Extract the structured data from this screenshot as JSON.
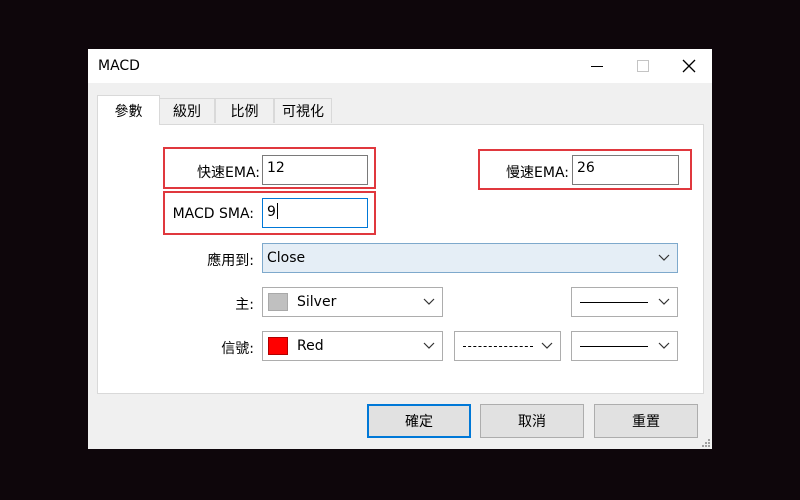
{
  "window": {
    "title": "MACD"
  },
  "tabs": [
    {
      "label": "參數",
      "active": true
    },
    {
      "label": "級別",
      "active": false
    },
    {
      "label": "比例",
      "active": false
    },
    {
      "label": "可視化",
      "active": false
    }
  ],
  "params": {
    "fast_ema_label": "快速EMA:",
    "fast_ema_value": "12",
    "slow_ema_label": "慢速EMA:",
    "slow_ema_value": "26",
    "macd_sma_label": "MACD SMA:",
    "macd_sma_value": "9",
    "apply_to_label": "應用到:",
    "apply_to_value": "Close",
    "main_label": "主:",
    "main_color_name": "Silver",
    "main_color": "#c0c0c0",
    "signal_label": "信號:",
    "signal_color_name": "Red",
    "signal_color": "#ff0000"
  },
  "buttons": {
    "ok": "確定",
    "cancel": "取消",
    "reset": "重置"
  },
  "highlight_color": "#e0383e",
  "accent_color": "#0078d7"
}
